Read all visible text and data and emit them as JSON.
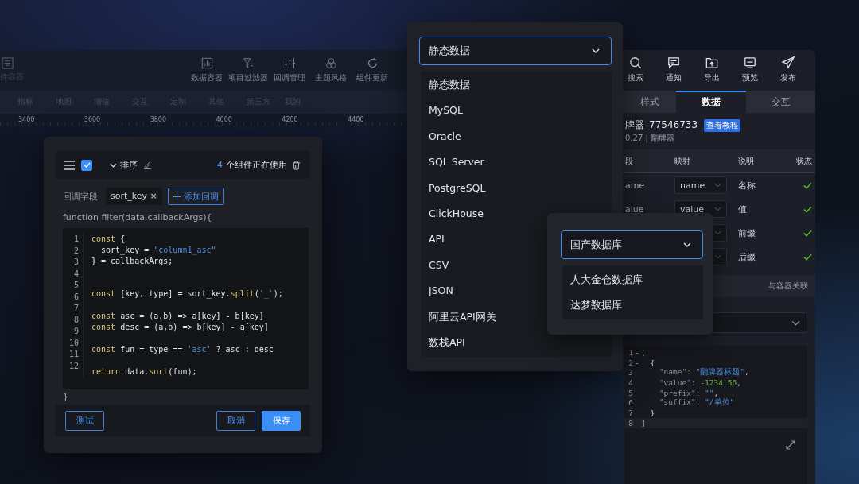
{
  "background_app": {
    "side_label": "件容器",
    "toolbar": [
      "数据容器",
      "项目过滤器",
      "回调管理",
      "主题风格",
      "组件更新"
    ],
    "categories": [
      "指标",
      "地图",
      "增值",
      "交互",
      "定制",
      "其他",
      "第三方",
      "我的"
    ],
    "ruler": [
      "3400",
      "3600",
      "3800",
      "4000",
      "4200",
      "4400"
    ]
  },
  "callback_panel": {
    "checked": true,
    "title": "排序",
    "count": "4",
    "usage_text": "个组件正在使用",
    "field_label": "回调字段",
    "tags": [
      {
        "text": "sort_key",
        "close": "×"
      }
    ],
    "add_button": "添加回调",
    "signature": "function filter(data,callbackArgs){",
    "line_numbers": [
      "1",
      "2",
      "3",
      "4",
      "5",
      "6",
      "7",
      "8",
      "9",
      "10",
      "11",
      "12"
    ],
    "code_blocks": [
      [
        [
          {
            "kind": "kw",
            "text": "const"
          },
          {
            "kind": "plain",
            "text": " {"
          }
        ],
        [
          {
            "kind": "plain",
            "text": "  sort_key = "
          },
          {
            "kind": "str",
            "text": "\"column1_asc\""
          }
        ],
        [
          {
            "kind": "plain",
            "text": "} = callbackArgs;"
          }
        ]
      ],
      [
        [
          {
            "kind": "kw",
            "text": "const"
          },
          {
            "kind": "plain",
            "text": " [key, type] = sort_key."
          },
          {
            "kind": "fn",
            "text": "split"
          },
          {
            "kind": "plain",
            "text": "("
          },
          {
            "kind": "str",
            "text": "'_'"
          },
          {
            "kind": "plain",
            "text": ");"
          }
        ]
      ],
      [
        [
          {
            "kind": "kw",
            "text": "const"
          },
          {
            "kind": "plain",
            "text": " asc = (a,b) => a[key] - b[key]"
          }
        ],
        [
          {
            "kind": "kw",
            "text": "const"
          },
          {
            "kind": "plain",
            "text": " desc = (a,b) => b[key] - a[key]"
          }
        ]
      ],
      [
        [
          {
            "kind": "kw",
            "text": "const"
          },
          {
            "kind": "plain",
            "text": " fun = type == "
          },
          {
            "kind": "str",
            "text": "'asc'"
          },
          {
            "kind": "plain",
            "text": " ? asc : desc"
          }
        ]
      ],
      [
        [
          {
            "kind": "kw",
            "text": "return"
          },
          {
            "kind": "plain",
            "text": " data."
          },
          {
            "kind": "fn",
            "text": "sort"
          },
          {
            "kind": "plain",
            "text": "(fun);"
          }
        ]
      ]
    ],
    "closing": "}",
    "buttons": [
      {
        "label": "测试",
        "kind": "outline"
      },
      {
        "label": "取消",
        "kind": "outline"
      },
      {
        "label": "保存",
        "kind": "primary"
      }
    ]
  },
  "source_dropdown": {
    "value": "静态数据",
    "options": [
      "静态数据",
      "MySQL",
      "Oracle",
      "SQL Server",
      "PostgreSQL",
      "ClickHouse",
      "API",
      "CSV",
      "JSON",
      "阿里云API网关",
      "数栈API"
    ]
  },
  "sub_dropdown": {
    "value": "国产数据库",
    "options": [
      "人大金仓数据库",
      "达梦数据库"
    ]
  },
  "right_panel": {
    "toolbar": [
      "搜索",
      "通知",
      "导出",
      "预览",
      "发布"
    ],
    "tabs": [
      {
        "label": "样式",
        "selected": false
      },
      {
        "label": "数据",
        "selected": true
      },
      {
        "label": "交互",
        "selected": false
      }
    ],
    "component_name": "牌器_77546733",
    "tutorial_badge": "查看教程",
    "version": "0.27 | 翻牌器",
    "columns": [
      "段",
      "映射",
      "说明",
      "状态"
    ],
    "fields": [
      {
        "field": "ame",
        "mapping": "name",
        "description": "名称",
        "ok": true
      },
      {
        "field": "alue",
        "mapping": "value",
        "description": "值",
        "ok": true
      },
      {
        "description": "前缀",
        "ok": true
      },
      {
        "description": "后缀",
        "ok": true
      }
    ],
    "link": "与容器关联",
    "json_lines": [
      {
        "number": "1",
        "fold": "-",
        "tokens": [
          {
            "kind": "plain",
            "text": "["
          }
        ]
      },
      {
        "number": "2",
        "fold": "-",
        "tokens": [
          {
            "kind": "plain",
            "text": "  {"
          }
        ]
      },
      {
        "number": "3",
        "tokens": [
          {
            "kind": "key",
            "text": "    \"name\": "
          },
          {
            "kind": "str",
            "text": "\"翻牌器标题\""
          },
          {
            "kind": "plain",
            "text": ","
          }
        ]
      },
      {
        "number": "4",
        "tokens": [
          {
            "kind": "key",
            "text": "    \"value\": "
          },
          {
            "kind": "num",
            "text": "-1234.56"
          },
          {
            "kind": "plain",
            "text": ","
          }
        ]
      },
      {
        "number": "5",
        "tokens": [
          {
            "kind": "key",
            "text": "    \"prefix\": "
          },
          {
            "kind": "str",
            "text": "\"\""
          },
          {
            "kind": "plain",
            "text": ","
          }
        ]
      },
      {
        "number": "6",
        "tokens": [
          {
            "kind": "key",
            "text": "    \"suffix\": "
          },
          {
            "kind": "str",
            "text": "\"/单位\""
          }
        ]
      },
      {
        "number": "7",
        "tokens": [
          {
            "kind": "plain",
            "text": "  }"
          }
        ]
      },
      {
        "number": "8",
        "tokens": [
          {
            "kind": "plain",
            "text": "]"
          }
        ]
      }
    ]
  }
}
